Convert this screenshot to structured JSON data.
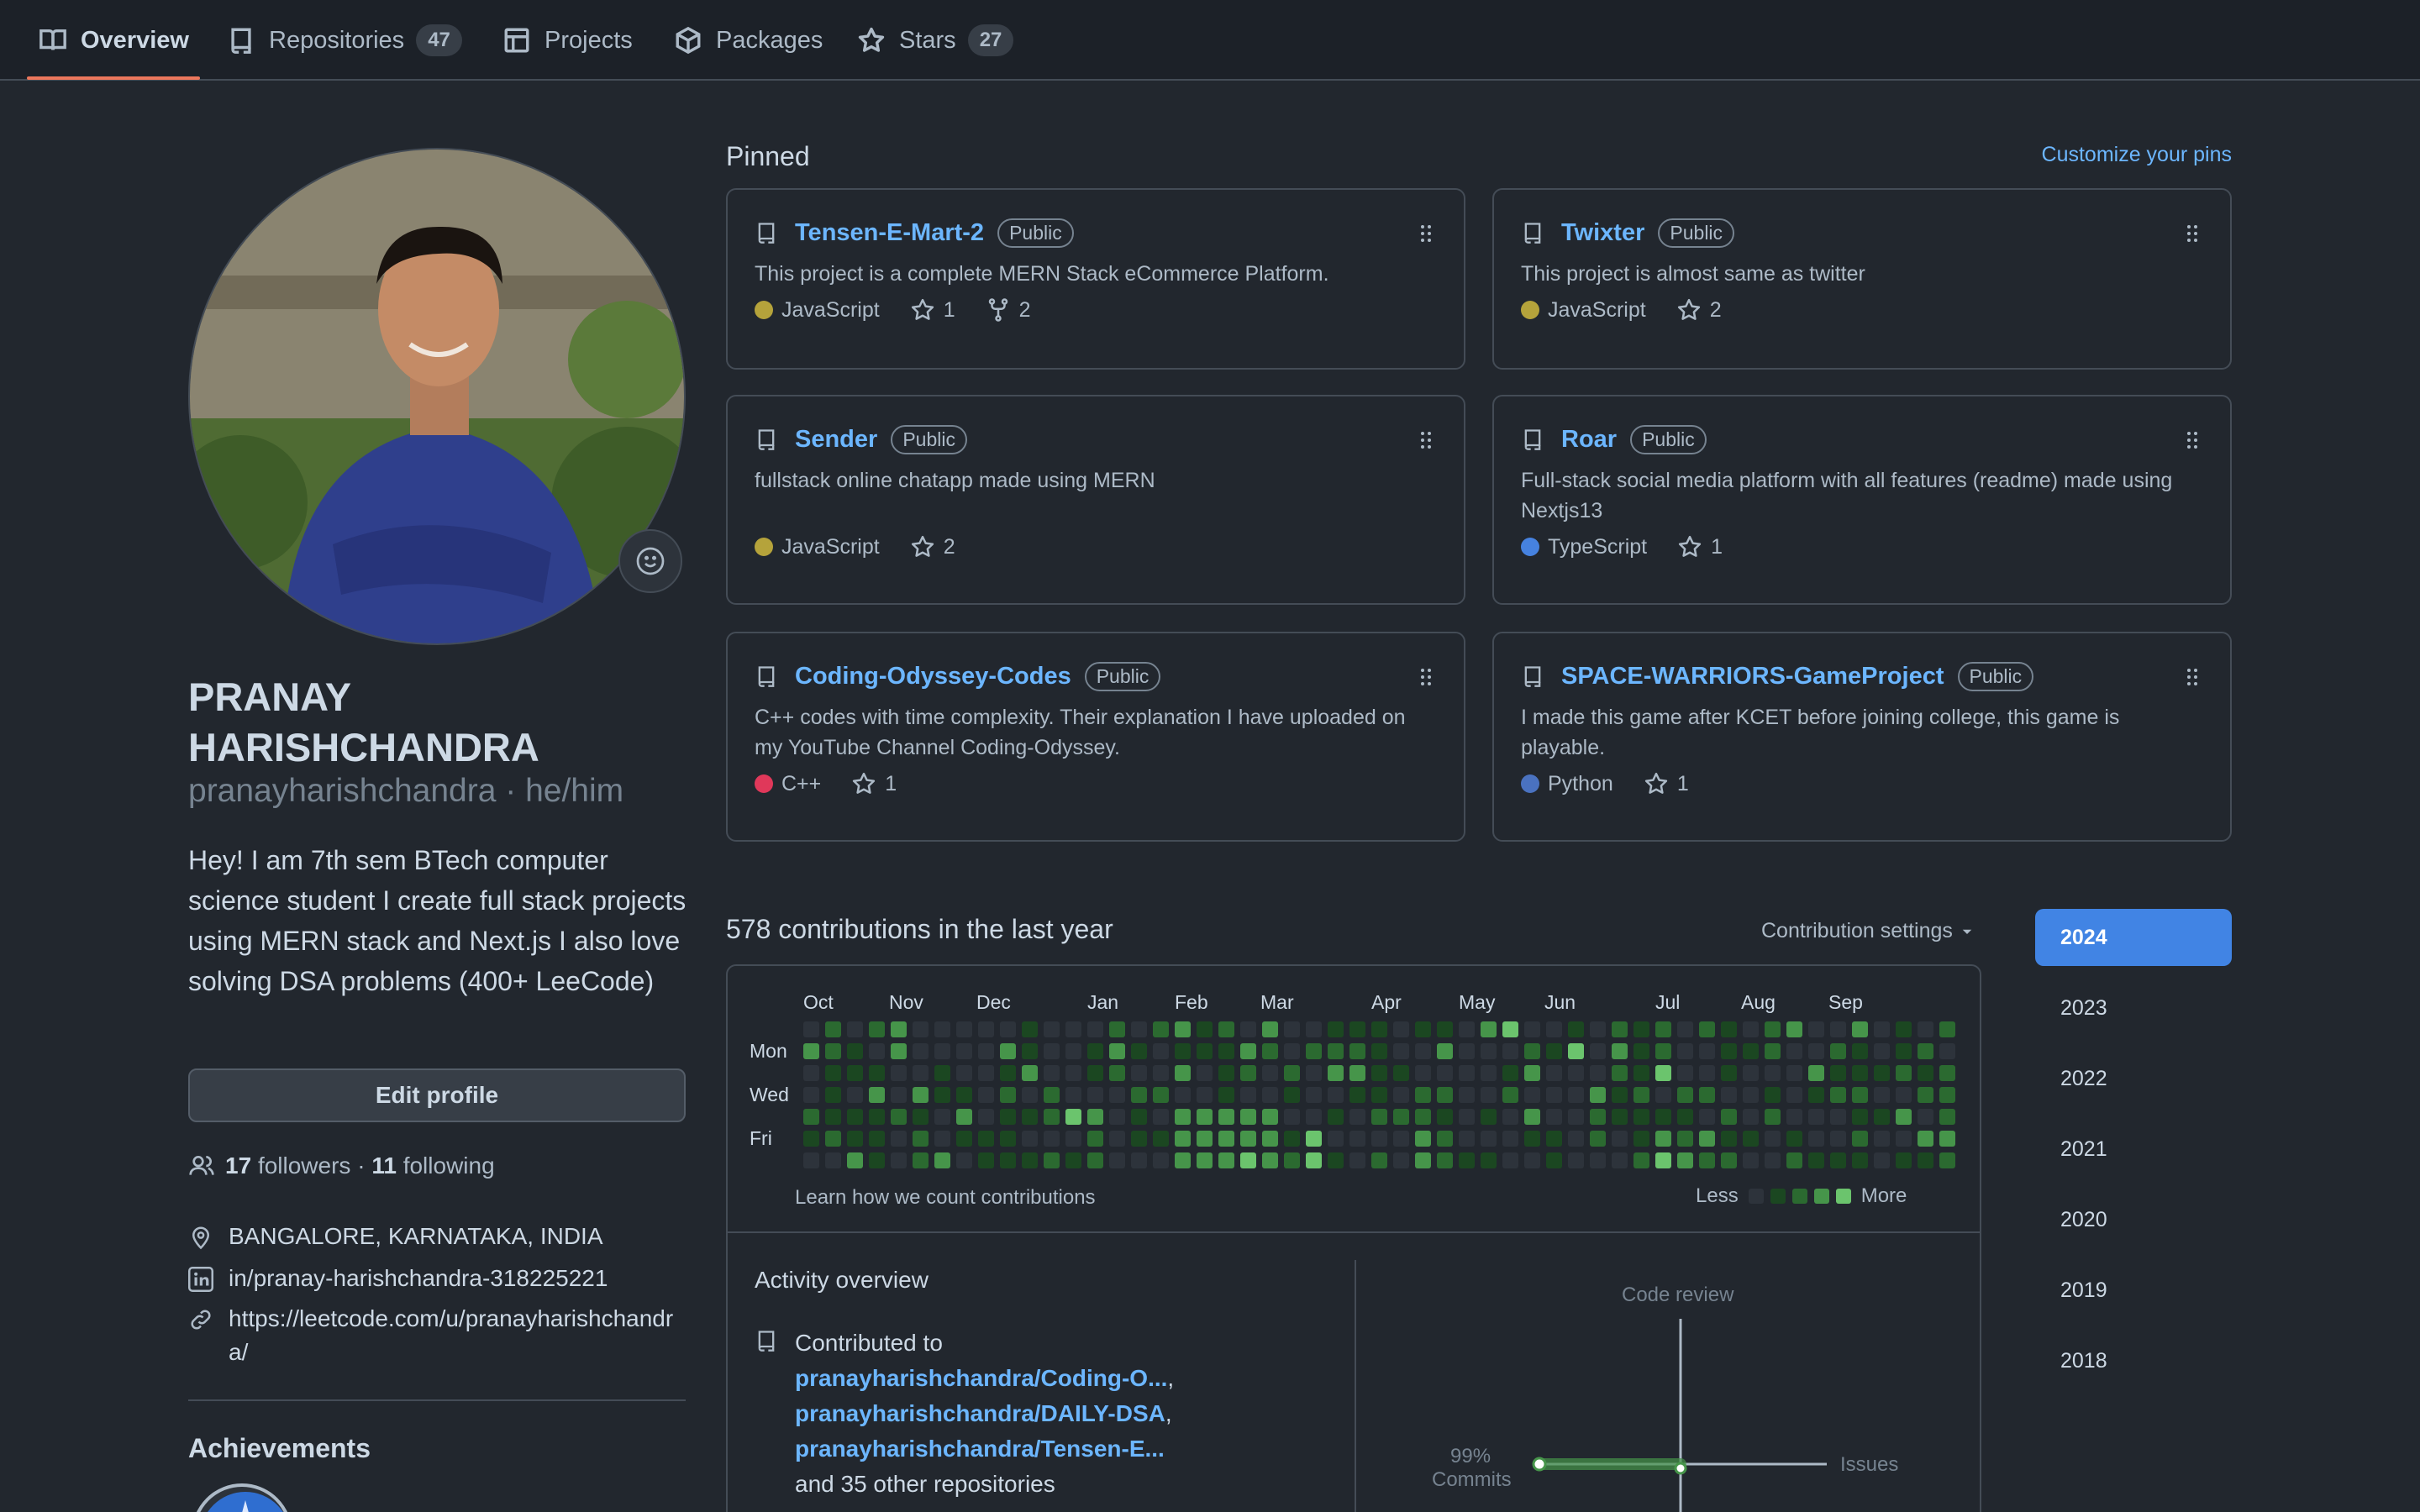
{
  "nav": {
    "tabs": [
      {
        "label": "Overview",
        "icon": "book-icon"
      },
      {
        "label": "Repositories",
        "count": "47",
        "icon": "repo-icon"
      },
      {
        "label": "Projects",
        "icon": "table-icon"
      },
      {
        "label": "Packages",
        "icon": "package-icon"
      },
      {
        "label": "Stars",
        "count": "27",
        "icon": "star-icon"
      }
    ],
    "active_color": "#ec775c"
  },
  "profile": {
    "name": "PRANAY HARISHCHANDRA",
    "handle": "pranayharishchandra · he/him",
    "bio": "Hey! I am 7th sem BTech computer science student I create full stack projects using MERN stack and Next.js I also love solving DSA problems (400+ LeeCode)",
    "edit_label": "Edit profile",
    "followers": "17",
    "followers_label": "followers",
    "separator": "·",
    "following": "11",
    "following_label": "following",
    "location": "BANGALORE, KARNATAKA, INDIA",
    "linkedin": "in/pranay-harishchandra-318225221",
    "website": "https://leetcode.com/u/pranayharishchandra/",
    "achievements_title": "Achievements"
  },
  "pinned": {
    "title": "Pinned",
    "customize": "Customize your pins",
    "visibility_label": "Public",
    "repos": [
      {
        "name": "Tensen-E-Mart-2",
        "desc": "This project is a complete MERN Stack eCommerce Platform.",
        "lang": "JavaScript",
        "lang_color": "#b5a33b",
        "stars": "1",
        "forks": "2"
      },
      {
        "name": "Twixter",
        "desc": "This project is almost same as twitter",
        "lang": "JavaScript",
        "lang_color": "#b5a33b",
        "stars": "2"
      },
      {
        "name": "Sender",
        "desc": "fullstack online chatapp made using MERN",
        "lang": "JavaScript",
        "lang_color": "#b5a33b",
        "stars": "2"
      },
      {
        "name": "Roar",
        "desc": "Full-stack social media platform with all features (readme) made using Nextjs13",
        "lang": "TypeScript",
        "lang_color": "#4682e0",
        "stars": "1"
      },
      {
        "name": "Coding-Odyssey-Codes",
        "desc": "C++ codes with time complexity. Their explanation I have uploaded on my YouTube Channel Coding-Odyssey.",
        "lang": "C++",
        "lang_color": "#e0385a",
        "stars": "1"
      },
      {
        "name": "SPACE-WARRIORS-GameProject",
        "desc": "I made this game after KCET before joining college, this game is playable.",
        "lang": "Python",
        "lang_color": "#4a72c0",
        "stars": "1"
      }
    ]
  },
  "contributions": {
    "title": "578 contributions in the last year",
    "settings": "Contribution settings",
    "months": [
      "Oct",
      "Nov",
      "Dec",
      "Jan",
      "Feb",
      "Mar",
      "Apr",
      "May",
      "Jun",
      "Jul",
      "Aug",
      "Sep"
    ],
    "days": [
      "Mon",
      "Wed",
      "Fri"
    ],
    "learn": "Learn how we count contributions",
    "less": "Less",
    "more": "More",
    "level_colors": [
      "#2d333b",
      "#1b4721",
      "#2b6a30",
      "#46954a",
      "#6bc46d"
    ]
  },
  "years": [
    "2024",
    "2023",
    "2022",
    "2021",
    "2020",
    "2019",
    "2018"
  ],
  "activity": {
    "title": "Activity overview",
    "contributed_to": "Contributed to",
    "repo1": "pranayharishchandra/Coding-O...",
    "repo2": "pranayharishchandra/DAILY-DSA",
    "repo3": "pranayharishchandra/Tensen-E...",
    "others": "and 35 other repositories",
    "code_review": "Code review",
    "issues": "Issues",
    "commits_pct": "99%",
    "commits": "Commits"
  }
}
